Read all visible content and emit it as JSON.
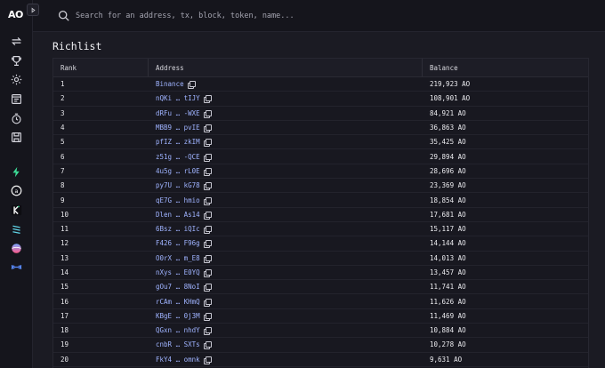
{
  "app": {
    "logo": "AO"
  },
  "search": {
    "placeholder": "Search for an address, tx, block, token, name..."
  },
  "sidebar": {
    "icons": [
      "transfer-icon",
      "trophy-icon",
      "settings-icon",
      "process-icon",
      "history-icon",
      "save-icon",
      "lightning-icon",
      "a-circle-icon",
      "k-icon",
      "layers-icon",
      "globe-icon",
      "bridge-icon"
    ]
  },
  "page": {
    "title": "Richlist"
  },
  "table": {
    "headers": {
      "rank": "Rank",
      "address": "Address",
      "balance": "Balance"
    },
    "rows": [
      {
        "rank": "1",
        "address": "Binance",
        "balance": "219,923 AO"
      },
      {
        "rank": "2",
        "address": "nQKi … tIJY",
        "balance": "108,901 AO"
      },
      {
        "rank": "3",
        "address": "dRFu … -WXE",
        "balance": "84,921 AO"
      },
      {
        "rank": "4",
        "address": "MBB9 … pvIE",
        "balance": "36,863 AO"
      },
      {
        "rank": "5",
        "address": "pfIZ … zkIM",
        "balance": "35,425 AO"
      },
      {
        "rank": "6",
        "address": "z51g … -QCE",
        "balance": "29,894 AO"
      },
      {
        "rank": "7",
        "address": "4u5g … rL0E",
        "balance": "28,696 AO"
      },
      {
        "rank": "8",
        "address": "py7U … kG78",
        "balance": "23,369 AO"
      },
      {
        "rank": "9",
        "address": "qE7G … hmio",
        "balance": "18,854 AO"
      },
      {
        "rank": "10",
        "address": "Dlen … As14",
        "balance": "17,681 AO"
      },
      {
        "rank": "11",
        "address": "6Bsz … iQIc",
        "balance": "15,117 AO"
      },
      {
        "rank": "12",
        "address": "F426 … F96g",
        "balance": "14,144 AO"
      },
      {
        "rank": "13",
        "address": "O0rX … m_E8",
        "balance": "14,013 AO"
      },
      {
        "rank": "14",
        "address": "nXys … E0YQ",
        "balance": "13,457 AO"
      },
      {
        "rank": "15",
        "address": "gOu7 … 8NoI",
        "balance": "11,741 AO"
      },
      {
        "rank": "16",
        "address": "rCAm … KHmQ",
        "balance": "11,626 AO"
      },
      {
        "rank": "17",
        "address": "KBgE … 0j3M",
        "balance": "11,469 AO"
      },
      {
        "rank": "18",
        "address": "QGxn … nhdY",
        "balance": "10,884 AO"
      },
      {
        "rank": "19",
        "address": "cnbR … SXTs",
        "balance": "10,278 AO"
      },
      {
        "rank": "20",
        "address": "FkY4 … omnk",
        "balance": "9,631 AO"
      }
    ]
  },
  "colors": {
    "background": "#1b1b23",
    "link": "#9fb3ff",
    "text": "#e6e6ea"
  }
}
